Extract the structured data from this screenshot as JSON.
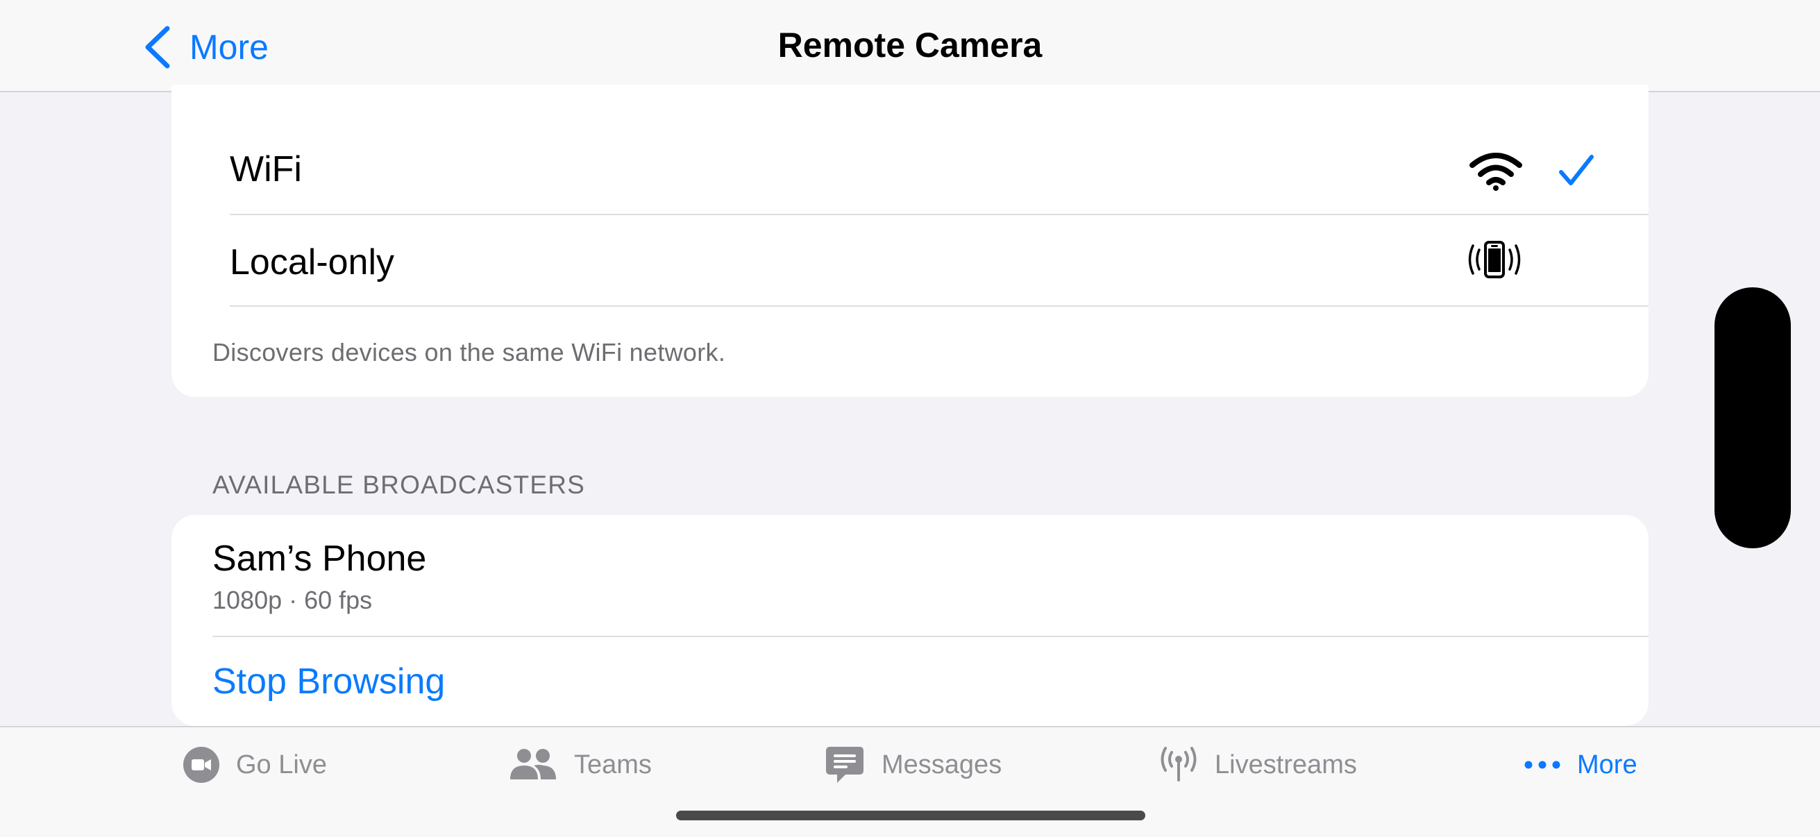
{
  "nav": {
    "back_label": "More",
    "title": "Remote Camera"
  },
  "network": {
    "options": [
      {
        "label": "WiFi",
        "icon": "wifi-icon",
        "selected": true
      },
      {
        "label": "Local-only",
        "icon": "phone-broadcast-icon",
        "selected": false
      }
    ],
    "footer": "Discovers devices on the same WiFi network."
  },
  "broadcasters": {
    "header": "AVAILABLE BROADCASTERS",
    "devices": [
      {
        "name": "Sam’s Phone",
        "details": "1080p · 60 fps"
      }
    ],
    "stop_label": "Stop Browsing"
  },
  "tabs": [
    {
      "label": "Go Live",
      "icon": "video-camera-icon",
      "active": false
    },
    {
      "label": "Teams",
      "icon": "people-icon",
      "active": false
    },
    {
      "label": "Messages",
      "icon": "message-bubble-icon",
      "active": false
    },
    {
      "label": "Livestreams",
      "icon": "antenna-icon",
      "active": false
    },
    {
      "label": "More",
      "icon": "ellipsis-icon",
      "active": true
    }
  ],
  "colors": {
    "accent": "#0a7aff",
    "inactive": "#8e8e93",
    "background": "#f2f2f7"
  }
}
